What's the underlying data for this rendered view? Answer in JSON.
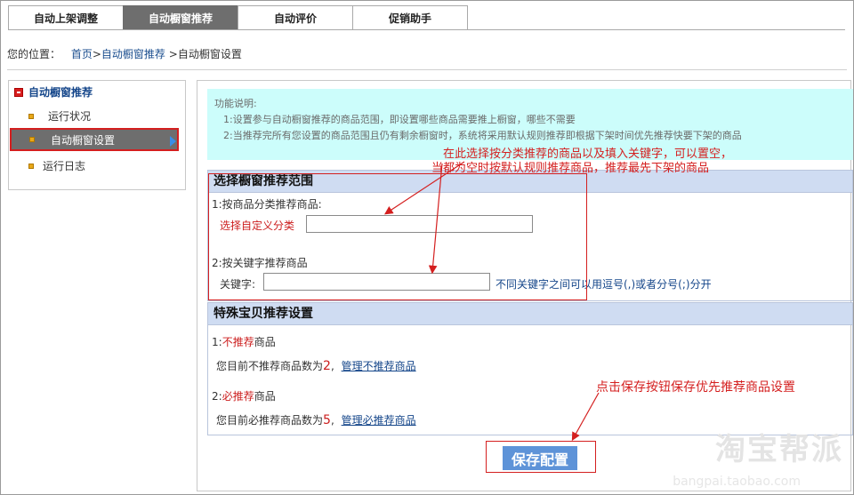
{
  "tabs": [
    {
      "label": "自动上架调整"
    },
    {
      "label": "自动橱窗推荐"
    },
    {
      "label": "自动评价"
    },
    {
      "label": "促销助手"
    }
  ],
  "breadcrumb": {
    "prefix": "您的位置：",
    "home": "首页",
    "sep1": ">",
    "link": "自动橱窗推荐",
    "sep2": ">",
    "current": "自动橱窗设置"
  },
  "sidebar": {
    "title": "自动橱窗推荐",
    "items": [
      {
        "label": "运行状况"
      },
      {
        "label": "自动橱窗设置"
      },
      {
        "label": "运行日志"
      }
    ]
  },
  "info": {
    "title": "功能说明:",
    "line1": "1:设置参与自动橱窗推荐的商品范围，即设置哪些商品需要推上橱窗，哪些不需要",
    "line2": "2:当推荐完所有您设置的商品范围且仍有剩余橱窗时，系统将采用默认规则推荐即根据下架时间优先推荐快要下架的商品"
  },
  "section1": {
    "title": "选择橱窗推荐范围",
    "cat_label": "1:按商品分类推荐商品:",
    "cat_select": "选择自定义分类",
    "cat_value": "",
    "kw_label": "2:按关键字推荐商品",
    "kw_field_label": "关键字:",
    "kw_value": "",
    "kw_hint": "不同关键字之间可以用逗号(,)或者分号(;)分开"
  },
  "section2": {
    "title": "特殊宝贝推荐设置",
    "no_prefix": "1:",
    "no_red": "不推荐",
    "no_suffix": "商品",
    "no_count_text": "您目前不推荐商品数为",
    "no_count": "2",
    "no_comma": ",",
    "no_link": "管理不推荐商品",
    "must_prefix": "2:",
    "must_red": "必推荐",
    "must_suffix": "商品",
    "must_count_text": "您目前必推荐商品数为",
    "must_count": "5",
    "must_comma": ",",
    "must_link": "管理必推荐商品"
  },
  "annotations": {
    "a1_line1": "在此选择按分类推荐的商品以及填入关键字，可以置空，",
    "a1_line2": "当都为空时按默认规则推荐商品，推荐最先下架的商品",
    "a2": "点击保存按钮保存优先推荐商品设置"
  },
  "save_label": "保存配置",
  "watermark": {
    "main": "淘宝帮派",
    "sub": "bangpai.taobao.com"
  }
}
